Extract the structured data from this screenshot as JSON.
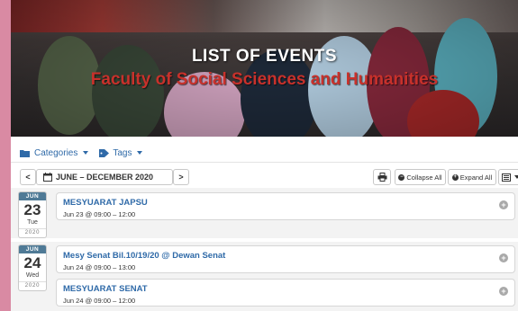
{
  "banner": {
    "title": "LIST OF  EVENTS",
    "subtitle": "Faculty of Social Sciences and Humanities"
  },
  "filters": {
    "categories_label": "Categories",
    "tags_label": "Tags"
  },
  "toolbar": {
    "prev_symbol": "<",
    "month_label": "JUNE – DECEMBER 2020",
    "next_symbol": ">",
    "collapse_label": "Collapse All",
    "expand_label": "Expand All"
  },
  "days": [
    {
      "month": "JUN",
      "day": "23",
      "weekday": "Tue",
      "year": "2020",
      "events": [
        {
          "title": "MESYUARAT JAPSU",
          "time": "Jun 23 @ 09:00 – 12:00"
        }
      ]
    },
    {
      "month": "JUN",
      "day": "24",
      "weekday": "Wed",
      "year": "2020",
      "events": [
        {
          "title": "Mesy Senat Bil.10/19/20 @ Dewan Senat",
          "time": "Jun 24 @ 09:00 – 13:00"
        },
        {
          "title": "MESYUARAT SENAT",
          "time": "Jun 24 @ 09:00 – 12:00"
        }
      ]
    }
  ],
  "colors": {
    "page_border": "#d98aa3",
    "link_blue": "#2f6aa8",
    "subtitle_red": "#c8312b",
    "date_header": "#4f7a96"
  },
  "icons": {
    "categories": "folder-icon",
    "tags": "tag-icon",
    "month": "calendar-icon",
    "print": "print-icon",
    "collapse": "minus-circle-icon",
    "expand": "plus-circle-icon",
    "view": "list-view-icon",
    "event_expand": "plus-circle-icon"
  }
}
